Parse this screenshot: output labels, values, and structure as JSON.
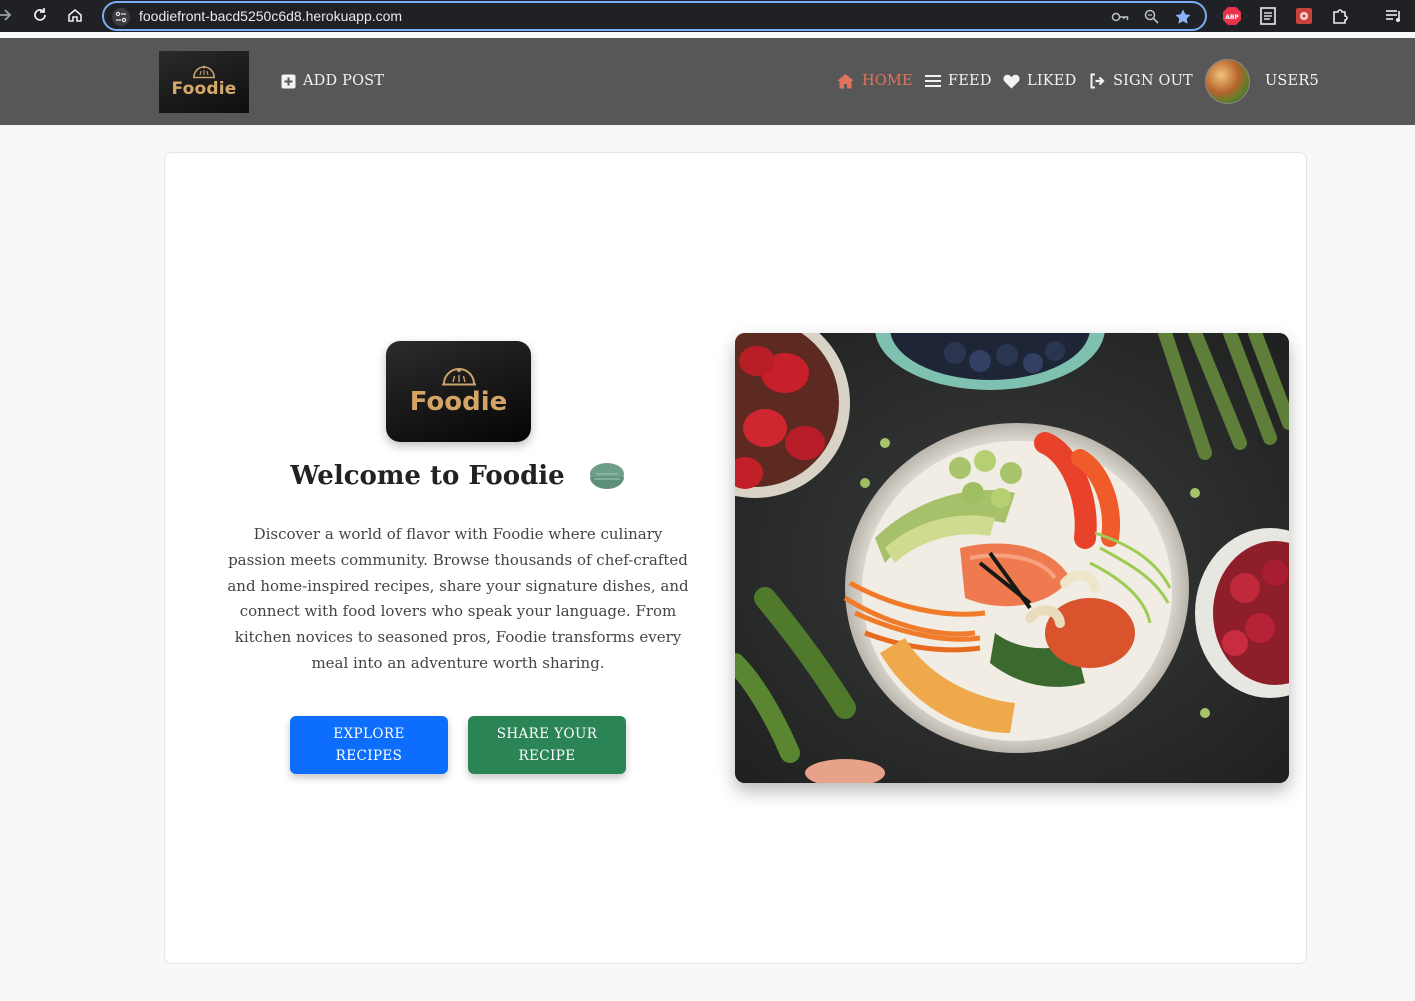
{
  "browser": {
    "url": "foodiefront-bacd5250c6d8.herokuapp.com",
    "icons": [
      "back-icon",
      "reload-icon",
      "home-icon",
      "site-settings-icon",
      "key-icon",
      "zoom-icon",
      "star-icon",
      "adblock-icon",
      "reader-icon",
      "extension-icon",
      "puzzle-icon",
      "media-icon"
    ]
  },
  "header": {
    "logo_text": "Foodie",
    "add_post": "ADD POST",
    "nav": {
      "home": "HOME",
      "feed": "FEED",
      "liked": "LIKED",
      "sign_out": "SIGN OUT",
      "user": "USER5"
    },
    "colors": {
      "background": "#575757",
      "active": "#e0735c"
    }
  },
  "hero": {
    "logo_text": "Foodie",
    "title": "Welcome to Foodie",
    "description": "Discover a world of flavor with Foodie where culinary passion meets community. Browse thousands of chef-crafted and home-inspired recipes, share your signature dishes, and connect with food lovers who speak your language. From kitchen novices to seasoned pros, Foodie transforms every meal into an adventure worth sharing.",
    "buttons": {
      "explore": "EXPLORE RECIPES",
      "share": "SHARE YOUR RECIPE"
    },
    "colors": {
      "explore": "#0d6efd",
      "share": "#2b8456"
    }
  }
}
